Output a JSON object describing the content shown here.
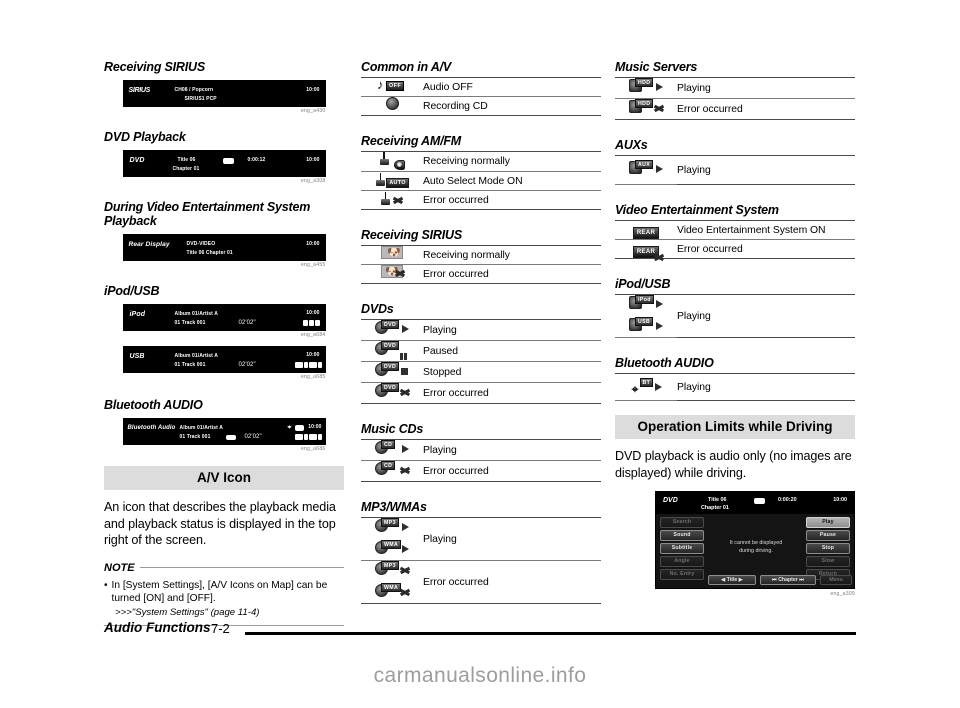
{
  "footer": {
    "title": "Audio Functions",
    "page": "7-2",
    "watermark": "carmanualsonline.info"
  },
  "column1": {
    "sections": [
      {
        "heading": "Receiving SIRIUS",
        "display": {
          "brand": "SIRIUS",
          "line1": "CH08 / Popcorn",
          "line2": "SIRIUS1   PCP",
          "clock": "10:00",
          "caption": "eng_a430"
        }
      },
      {
        "heading": "DVD Playback",
        "display": {
          "brand": "DVD",
          "line1": "Title 06",
          "line2": "Chapter 01",
          "time": "0:00:12",
          "clock": "10:00",
          "caption": "eng_a308"
        }
      },
      {
        "heading": "During Video Entertainment System Playback",
        "display": {
          "brand": "Rear Display",
          "line1": "DVD-VIDEO",
          "line2": "Title 06   Chapter 01",
          "clock": "10:00",
          "caption": "eng_a455"
        }
      },
      {
        "heading": "iPod/USB",
        "display": {
          "brand": "iPod",
          "line1": "Album 01/Artist A",
          "line2": "01 Track 001",
          "time": "02'02\"",
          "clock": "10:00",
          "caption": "eng_a684"
        },
        "display2": {
          "brand": "USB",
          "line1": "Album 01/Artist A",
          "line2": "01 Track 001",
          "time": "02'02\"",
          "clock": "10:00",
          "caption": "eng_a685"
        }
      },
      {
        "heading": "Bluetooth AUDIO",
        "display": {
          "brand": "Bluetooth Audio",
          "line1": "Album 01/Artist A",
          "line2": "01 Track 001",
          "time": "02'02\"",
          "clock": "10:00",
          "caption": "eng_a686"
        }
      }
    ],
    "av_icon": {
      "band_title": "A/V Icon",
      "body": "An icon that describes the playback media and playback status is displayed in the top right of the screen.",
      "note_label": "NOTE",
      "note_bullet": "In [System Settings], [A/V Icons on Map] can be turned [ON] and [OFF].",
      "note_ref": ">>>\"System Settings\" (page 11-4)"
    }
  },
  "column2": {
    "groups": [
      {
        "heading": "Common in A/V",
        "rows": [
          {
            "icon": "audio-off-icon",
            "label": "Audio OFF"
          },
          {
            "icon": "recording-cd-icon",
            "label": "Recording CD"
          }
        ]
      },
      {
        "heading": "Receiving AM/FM",
        "rows": [
          {
            "icon": "antenna-radio-icon",
            "label": "Receiving normally"
          },
          {
            "icon": "antenna-auto-icon",
            "label": "Auto Select Mode ON"
          },
          {
            "icon": "antenna-error-icon",
            "label": "Error occurred"
          }
        ]
      },
      {
        "heading": "Receiving SIRIUS",
        "rows": [
          {
            "icon": "sirius-dog-icon",
            "label": "Receiving normally"
          },
          {
            "icon": "sirius-dog-error-icon",
            "label": "Error occurred"
          }
        ]
      },
      {
        "heading": "DVDs",
        "rows": [
          {
            "icon": "dvd-play-icon",
            "label": "Playing"
          },
          {
            "icon": "dvd-pause-icon",
            "label": "Paused"
          },
          {
            "icon": "dvd-stop-icon",
            "label": "Stopped"
          },
          {
            "icon": "dvd-error-icon",
            "label": "Error occurred"
          }
        ]
      },
      {
        "heading": "Music CDs",
        "rows": [
          {
            "icon": "cd-play-icon",
            "label": "Playing"
          },
          {
            "icon": "cd-error-icon",
            "label": "Error occurred"
          }
        ]
      },
      {
        "heading": "MP3/WMAs",
        "rows": [
          {
            "icon": "mp3-wma-play-icon",
            "label": "Playing"
          },
          {
            "icon": "mp3-wma-error-icon",
            "label": "Error occurred"
          }
        ]
      }
    ]
  },
  "column3": {
    "groups": [
      {
        "heading": "Music Servers",
        "rows": [
          {
            "icon": "hdd-play-icon",
            "label": "Playing"
          },
          {
            "icon": "hdd-error-icon",
            "label": "Error occurred"
          }
        ]
      },
      {
        "heading": "AUXs",
        "rows": [
          {
            "icon": "aux-play-icon",
            "label": "Playing"
          }
        ]
      },
      {
        "heading": "Video Entertainment System",
        "rows": [
          {
            "icon": "rear-on-icon",
            "label": "Video Entertainment System ON"
          },
          {
            "icon": "rear-error-icon",
            "label": "Error occurred"
          }
        ]
      },
      {
        "heading": "iPod/USB",
        "rows": [
          {
            "icon": "ipod-usb-play-icon",
            "label": "Playing"
          }
        ]
      },
      {
        "heading": "Bluetooth AUDIO",
        "rows": [
          {
            "icon": "bt-play-icon",
            "label": "Playing"
          }
        ]
      }
    ],
    "driving": {
      "band_title": "Operation Limits while Driving",
      "body": "DVD playback is audio only (no images are displayed) while driving.",
      "screen": {
        "brand": "DVD",
        "title": "Title 06",
        "chapter": "Chapter 01",
        "time": "0:00:20",
        "clock": "10:00",
        "message_line1": "It cannot be displayed",
        "message_line2": "during driving.",
        "left_buttons": [
          "Search",
          "Sound",
          "Subtitle",
          "Angle",
          "No. Entry"
        ],
        "right_buttons": [
          "Play",
          "Pause",
          "Stop",
          "Slow",
          "Return"
        ],
        "bottom_buttons": [
          "Title",
          "Chapter",
          "Menu"
        ],
        "caption": "eng_a309"
      }
    }
  }
}
